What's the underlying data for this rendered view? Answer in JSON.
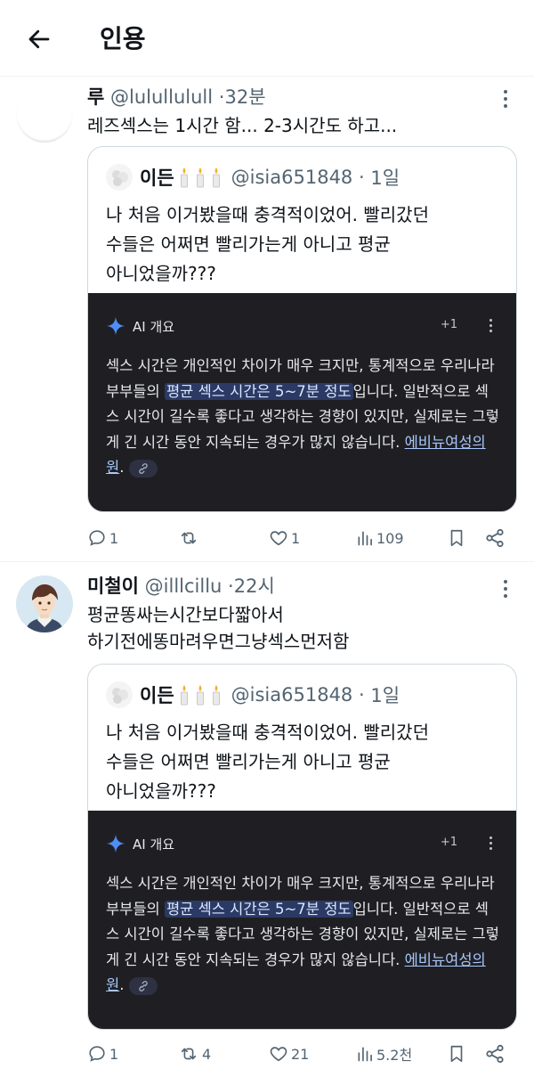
{
  "header": {
    "title": "인용"
  },
  "posts": [
    {
      "name": "루",
      "handle": "@lulullulull",
      "time": "32분",
      "text_lines": [
        "레즈섹스는 1시간 함... 2-3시간도 하고..."
      ],
      "quote": {
        "name": "이든",
        "handle": "@isia651848",
        "time": "1일",
        "text_lines": [
          "나 처음 이거봤을때 충격적이었어. 빨리갔던",
          "수들은 어쩌면 빨리가는게 아니고 평균",
          "아니었을까???"
        ],
        "ai": {
          "label": "AI 개요",
          "plus": "+1",
          "text_before": "섹스 시간은 개인적인 차이가 매우 크지만, 통계적으로 우리나라 부부들의 ",
          "highlight": "평균 섹스 시간은 5~7분 정도",
          "text_after": "입니다. 일반적으로 섹스 시간이 길수록 좋다고 생각하는 경향이 있지만, 실제로는 그렇게 긴 시간 동안 지속되는 경우가 많지 않습니다. ",
          "source": "에비뉴여성의원",
          "period": "."
        }
      },
      "actions": {
        "replies": "1",
        "retweets": "",
        "likes": "1",
        "views": "109"
      }
    },
    {
      "name": "미철이",
      "handle": "@illlcillu",
      "time": "22시",
      "text_lines": [
        "평균똥싸는시간보다짧아서",
        "하기전에똥마려우면그냥섹스먼저함"
      ],
      "quote": {
        "name": "이든",
        "handle": "@isia651848",
        "time": "1일",
        "text_lines": [
          "나 처음 이거봤을때 충격적이었어. 빨리갔던",
          "수들은 어쩌면 빨리가는게 아니고 평균",
          "아니었을까???"
        ],
        "ai": {
          "label": "AI 개요",
          "plus": "+1",
          "text_before": "섹스 시간은 개인적인 차이가 매우 크지만, 통계적으로 우리나라 부부들의 ",
          "highlight": "평균 섹스 시간은 5~7분 정도",
          "text_after": "입니다. 일반적으로 섹스 시간이 길수록 좋다고 생각하는 경향이 있지만, 실제로는 그렇게 긴 시간 동안 지속되는 경우가 많지 않습니다. ",
          "source": "에비뉴여성의원",
          "period": "."
        }
      },
      "actions": {
        "replies": "1",
        "retweets": "4",
        "likes": "21",
        "views": "5.2천"
      }
    }
  ],
  "icons": {
    "back": "arrow-left-icon",
    "more": "more-vertical-icon",
    "sparkle": "sparkle-icon",
    "link": "link-icon",
    "reply": "reply-icon",
    "retweet": "retweet-icon",
    "like": "heart-icon",
    "views": "views-icon",
    "bookmark": "bookmark-icon",
    "share": "share-icon"
  },
  "colors": {
    "ai_box": "#1f1f23",
    "highlight": "#2a3a64",
    "source_link": "#a8c7fa",
    "meta_text": "#536471"
  }
}
